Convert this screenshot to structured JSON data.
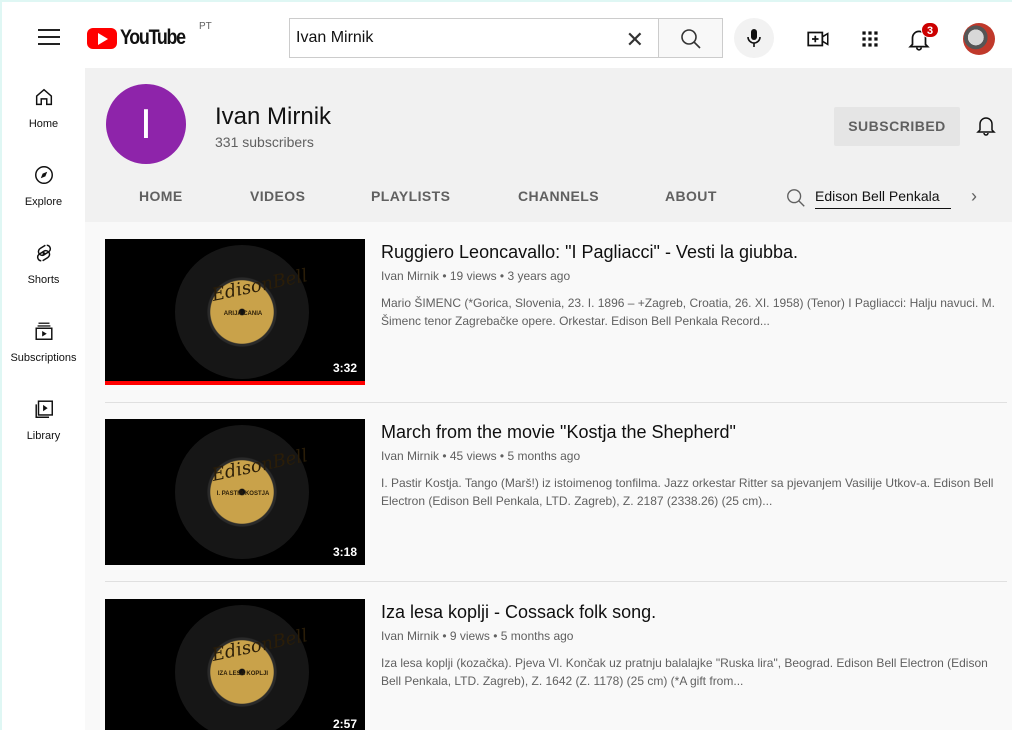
{
  "header": {
    "logo_text": "YouTube",
    "country_code": "PT",
    "search_value": "Ivan Mirnik",
    "notification_count": "3",
    "icons": [
      "menu-icon",
      "search-icon",
      "clear-icon",
      "mic-icon",
      "create-video-icon",
      "apps-icon",
      "bell-icon"
    ]
  },
  "sidebar": {
    "items": [
      {
        "label": "Home",
        "icon": "home-icon"
      },
      {
        "label": "Explore",
        "icon": "compass-icon"
      },
      {
        "label": "Shorts",
        "icon": "shorts-icon"
      },
      {
        "label": "Subscriptions",
        "icon": "subscriptions-icon"
      },
      {
        "label": "Library",
        "icon": "library-icon"
      }
    ]
  },
  "channel": {
    "avatar_letter": "I",
    "avatar_color": "#8e24aa",
    "name": "Ivan Mirnik",
    "subscribers": "331 subscribers",
    "subscribe_label": "SUBSCRIBED",
    "tabs": [
      "HOME",
      "VIDEOS",
      "PLAYLISTS",
      "CHANNELS",
      "ABOUT"
    ],
    "tab_search_value": "Edison Bell Penkala"
  },
  "videos": [
    {
      "title": "Ruggiero Leoncavallo: \"I Pagliacci\" - Vesti la giubba.",
      "meta": "Ivan Mirnik • 19 views • 3 years ago",
      "description": "Mario ŠIMENC (*Gorica, Slovenia, 23. I. 1896 – +Zagreb, Croatia, 26. XI. 1958) (Tenor) I Pagliacci: Halju navuci. M. Šimenc tenor Zagrebačke opere. Orkestar. Edison Bell Penkala Record...",
      "duration": "3:32",
      "watched_fraction": 1.0,
      "record_brand": "EdisonBell",
      "record_label": "ARIJA CANIA"
    },
    {
      "title": "March from the movie \"Kostja the Shepherd\"",
      "meta": "Ivan Mirnik • 45 views • 5 months ago",
      "description": "I. Pastir Kostja. Tango (Marš!) iz istoimenog tonfilma. Jazz orkestar Ritter sa pjevanjem Vasilije Utkov-a. Edison Bell Electron (Edison Bell Penkala, LTD. Zagreb), Z. 2187 (2338.26) (25 cm)...",
      "duration": "3:18",
      "watched_fraction": 0,
      "record_brand": "EdisonBell",
      "record_label": "I. PASTIR KOSTJA"
    },
    {
      "title": "Iza lesa koplji - Cossack folk song.",
      "meta": "Ivan Mirnik • 9 views • 5 months ago",
      "description": "Iza lesa koplji (kozačka). Pjeva Vl. Končak uz pratnju balalajke \"Ruska lira\", Beograd. Edison Bell Electron (Edison Bell Penkala, LTD. Zagreb), Z. 1642 (Z. 1178) (25 cm) (*A gift from...",
      "duration": "2:57",
      "watched_fraction": 0,
      "record_brand": "EdisonBell",
      "record_label": "IZA LESA KOPLJI"
    }
  ]
}
